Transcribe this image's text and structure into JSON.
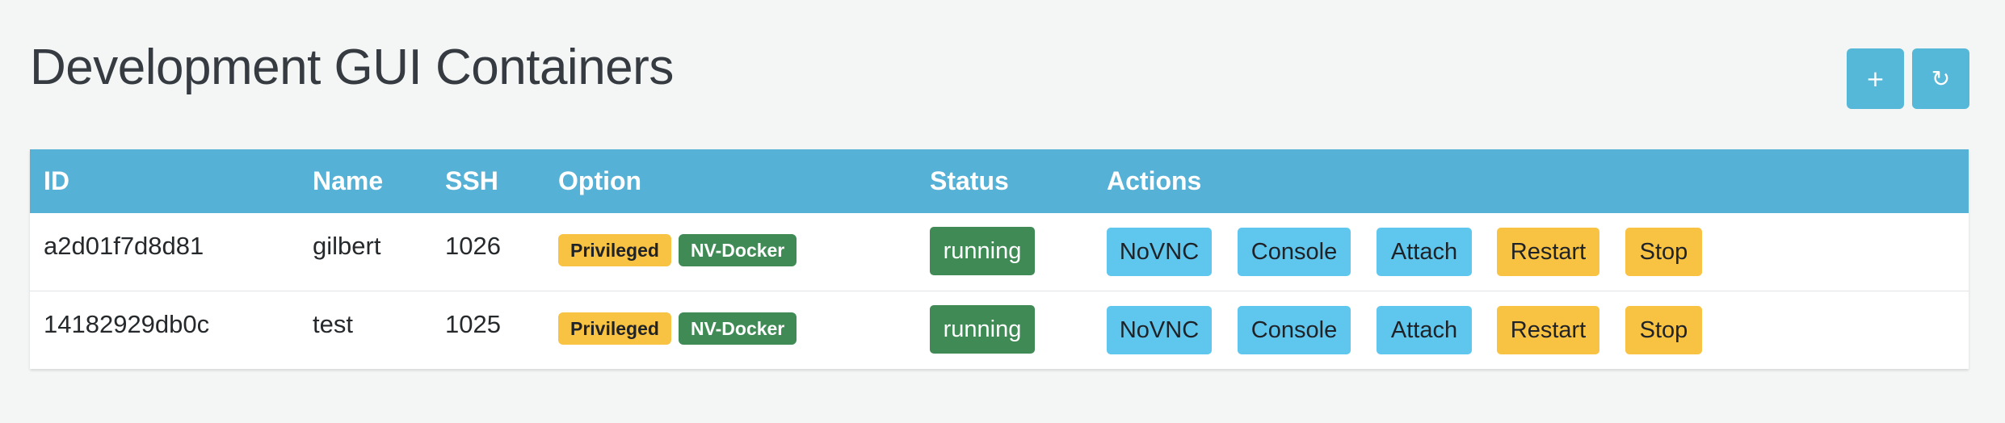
{
  "page": {
    "title": "Development GUI Containers"
  },
  "toolbar": {
    "add_label": "+",
    "refresh_label": "↻"
  },
  "table": {
    "headers": {
      "id": "ID",
      "name": "Name",
      "ssh": "SSH",
      "option": "Option",
      "status": "Status",
      "actions": "Actions"
    },
    "rows": [
      {
        "id": "a2d01f7d8d81",
        "name": "gilbert",
        "ssh": "1026",
        "options": [
          "Privileged",
          "NV-Docker"
        ],
        "status": "running",
        "actions": [
          "NoVNC",
          "Console",
          "Attach",
          "Restart",
          "Stop"
        ]
      },
      {
        "id": "14182929db0c",
        "name": "test",
        "ssh": "1025",
        "options": [
          "Privileged",
          "NV-Docker"
        ],
        "status": "running",
        "actions": [
          "NoVNC",
          "Console",
          "Attach",
          "Restart",
          "Stop"
        ]
      }
    ]
  },
  "colors": {
    "header_bg": "#55b1d6",
    "tool_button": "#55b8d8",
    "action_blue": "#5fc6ee",
    "action_yellow": "#f8c243",
    "success_green": "#3f8a55",
    "page_bg": "#f4f6f5"
  }
}
